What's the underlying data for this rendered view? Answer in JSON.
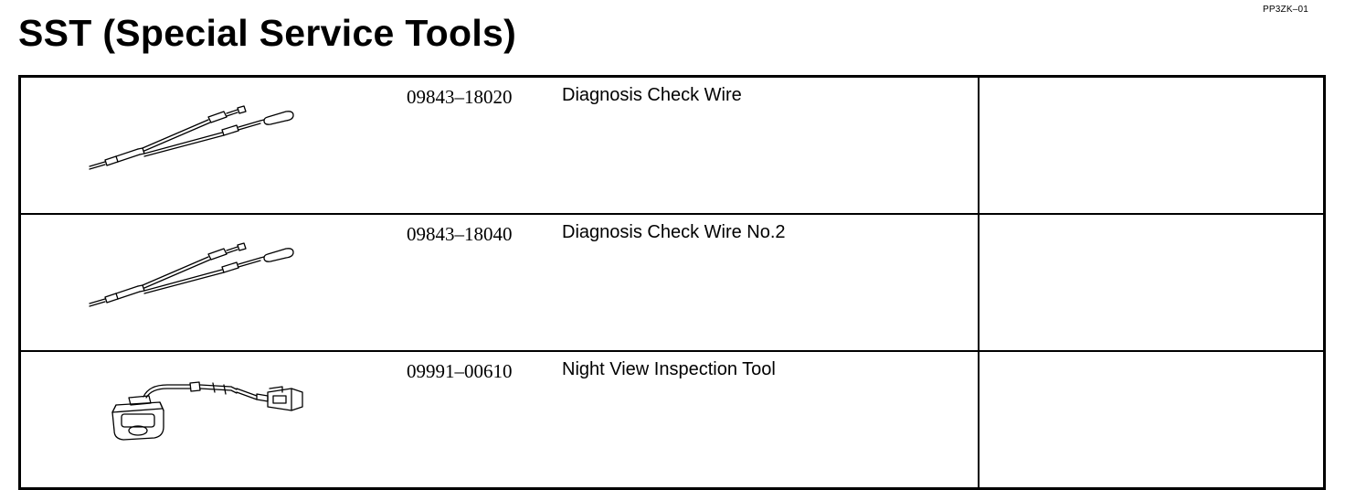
{
  "header": {
    "doc_code": "PP3ZK–01",
    "title": "SST (Special Service Tools)"
  },
  "tools": [
    {
      "part_number": "09843–18020",
      "name": "Diagnosis Check Wire",
      "icon": "diagnosis-check-wire-illustration",
      "remark": ""
    },
    {
      "part_number": "09843–18040",
      "name": "Diagnosis Check Wire No.2",
      "icon": "diagnosis-check-wire-illustration",
      "remark": ""
    },
    {
      "part_number": "09991–00610",
      "name": "Night View Inspection Tool",
      "icon": "night-view-inspection-tool-illustration",
      "remark": ""
    }
  ]
}
